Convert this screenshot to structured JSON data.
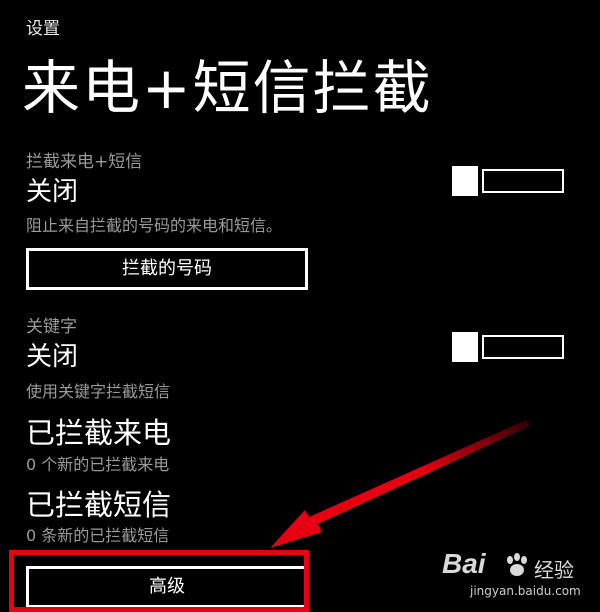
{
  "app_label": "设置",
  "page_title": "来电+短信拦截",
  "call_sms_block": {
    "section_label": "拦截来电+短信",
    "state": "关闭",
    "toggle_on": false,
    "description": "阻止来自拦截的号码的来电和短信。",
    "blocked_numbers_button": "拦截的号码"
  },
  "keywords": {
    "section_label": "关键字",
    "state": "关闭",
    "toggle_on": false,
    "description": "使用关键字拦截短信"
  },
  "blocked_calls": {
    "title": "已拦截来电",
    "subtitle": "0 个新的已拦截来电"
  },
  "blocked_sms": {
    "title": "已拦截短信",
    "subtitle": "0 条新的已拦截短信"
  },
  "advanced_button": "高级",
  "annotation_color": "#e60012",
  "watermark": {
    "brand": "Bai",
    "suffix": "经验",
    "url": "jingyan.baidu.com"
  }
}
